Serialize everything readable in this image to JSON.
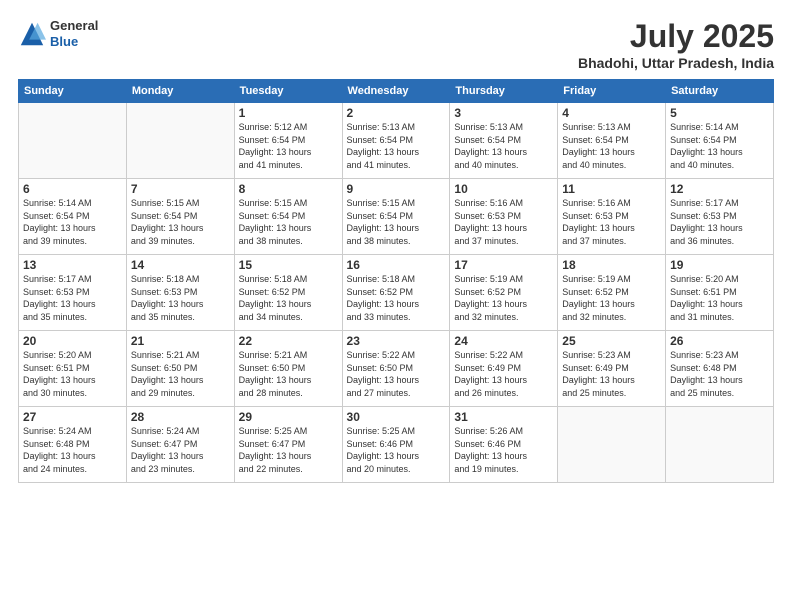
{
  "header": {
    "logo_general": "General",
    "logo_blue": "Blue",
    "month_title": "July 2025",
    "location": "Bhadohi, Uttar Pradesh, India"
  },
  "days_of_week": [
    "Sunday",
    "Monday",
    "Tuesday",
    "Wednesday",
    "Thursday",
    "Friday",
    "Saturday"
  ],
  "weeks": [
    [
      {
        "day": "",
        "info": ""
      },
      {
        "day": "",
        "info": ""
      },
      {
        "day": "1",
        "info": "Sunrise: 5:12 AM\nSunset: 6:54 PM\nDaylight: 13 hours\nand 41 minutes."
      },
      {
        "day": "2",
        "info": "Sunrise: 5:13 AM\nSunset: 6:54 PM\nDaylight: 13 hours\nand 41 minutes."
      },
      {
        "day": "3",
        "info": "Sunrise: 5:13 AM\nSunset: 6:54 PM\nDaylight: 13 hours\nand 40 minutes."
      },
      {
        "day": "4",
        "info": "Sunrise: 5:13 AM\nSunset: 6:54 PM\nDaylight: 13 hours\nand 40 minutes."
      },
      {
        "day": "5",
        "info": "Sunrise: 5:14 AM\nSunset: 6:54 PM\nDaylight: 13 hours\nand 40 minutes."
      }
    ],
    [
      {
        "day": "6",
        "info": "Sunrise: 5:14 AM\nSunset: 6:54 PM\nDaylight: 13 hours\nand 39 minutes."
      },
      {
        "day": "7",
        "info": "Sunrise: 5:15 AM\nSunset: 6:54 PM\nDaylight: 13 hours\nand 39 minutes."
      },
      {
        "day": "8",
        "info": "Sunrise: 5:15 AM\nSunset: 6:54 PM\nDaylight: 13 hours\nand 38 minutes."
      },
      {
        "day": "9",
        "info": "Sunrise: 5:15 AM\nSunset: 6:54 PM\nDaylight: 13 hours\nand 38 minutes."
      },
      {
        "day": "10",
        "info": "Sunrise: 5:16 AM\nSunset: 6:53 PM\nDaylight: 13 hours\nand 37 minutes."
      },
      {
        "day": "11",
        "info": "Sunrise: 5:16 AM\nSunset: 6:53 PM\nDaylight: 13 hours\nand 37 minutes."
      },
      {
        "day": "12",
        "info": "Sunrise: 5:17 AM\nSunset: 6:53 PM\nDaylight: 13 hours\nand 36 minutes."
      }
    ],
    [
      {
        "day": "13",
        "info": "Sunrise: 5:17 AM\nSunset: 6:53 PM\nDaylight: 13 hours\nand 35 minutes."
      },
      {
        "day": "14",
        "info": "Sunrise: 5:18 AM\nSunset: 6:53 PM\nDaylight: 13 hours\nand 35 minutes."
      },
      {
        "day": "15",
        "info": "Sunrise: 5:18 AM\nSunset: 6:52 PM\nDaylight: 13 hours\nand 34 minutes."
      },
      {
        "day": "16",
        "info": "Sunrise: 5:18 AM\nSunset: 6:52 PM\nDaylight: 13 hours\nand 33 minutes."
      },
      {
        "day": "17",
        "info": "Sunrise: 5:19 AM\nSunset: 6:52 PM\nDaylight: 13 hours\nand 32 minutes."
      },
      {
        "day": "18",
        "info": "Sunrise: 5:19 AM\nSunset: 6:52 PM\nDaylight: 13 hours\nand 32 minutes."
      },
      {
        "day": "19",
        "info": "Sunrise: 5:20 AM\nSunset: 6:51 PM\nDaylight: 13 hours\nand 31 minutes."
      }
    ],
    [
      {
        "day": "20",
        "info": "Sunrise: 5:20 AM\nSunset: 6:51 PM\nDaylight: 13 hours\nand 30 minutes."
      },
      {
        "day": "21",
        "info": "Sunrise: 5:21 AM\nSunset: 6:50 PM\nDaylight: 13 hours\nand 29 minutes."
      },
      {
        "day": "22",
        "info": "Sunrise: 5:21 AM\nSunset: 6:50 PM\nDaylight: 13 hours\nand 28 minutes."
      },
      {
        "day": "23",
        "info": "Sunrise: 5:22 AM\nSunset: 6:50 PM\nDaylight: 13 hours\nand 27 minutes."
      },
      {
        "day": "24",
        "info": "Sunrise: 5:22 AM\nSunset: 6:49 PM\nDaylight: 13 hours\nand 26 minutes."
      },
      {
        "day": "25",
        "info": "Sunrise: 5:23 AM\nSunset: 6:49 PM\nDaylight: 13 hours\nand 25 minutes."
      },
      {
        "day": "26",
        "info": "Sunrise: 5:23 AM\nSunset: 6:48 PM\nDaylight: 13 hours\nand 25 minutes."
      }
    ],
    [
      {
        "day": "27",
        "info": "Sunrise: 5:24 AM\nSunset: 6:48 PM\nDaylight: 13 hours\nand 24 minutes."
      },
      {
        "day": "28",
        "info": "Sunrise: 5:24 AM\nSunset: 6:47 PM\nDaylight: 13 hours\nand 23 minutes."
      },
      {
        "day": "29",
        "info": "Sunrise: 5:25 AM\nSunset: 6:47 PM\nDaylight: 13 hours\nand 22 minutes."
      },
      {
        "day": "30",
        "info": "Sunrise: 5:25 AM\nSunset: 6:46 PM\nDaylight: 13 hours\nand 20 minutes."
      },
      {
        "day": "31",
        "info": "Sunrise: 5:26 AM\nSunset: 6:46 PM\nDaylight: 13 hours\nand 19 minutes."
      },
      {
        "day": "",
        "info": ""
      },
      {
        "day": "",
        "info": ""
      }
    ]
  ]
}
